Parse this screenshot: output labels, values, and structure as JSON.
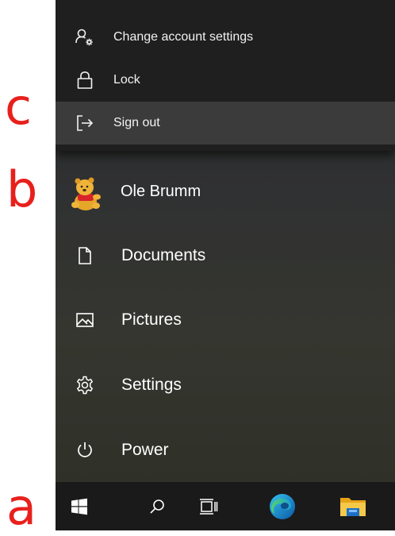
{
  "annotations": {
    "c": "c",
    "b": "b",
    "a": "a",
    "color": "#e8201c"
  },
  "flyout": {
    "items": [
      {
        "label": "Change account settings",
        "icon": "account-settings-icon"
      },
      {
        "label": "Lock",
        "icon": "lock-icon"
      },
      {
        "label": "Sign out",
        "icon": "sign-out-icon",
        "highlighted": true
      }
    ]
  },
  "user": {
    "name": "Ole Brumm",
    "avatar": "winnie-the-pooh-avatar"
  },
  "menu": {
    "items": [
      {
        "label": "Documents",
        "icon": "document-icon"
      },
      {
        "label": "Pictures",
        "icon": "pictures-icon"
      },
      {
        "label": "Settings",
        "icon": "gear-icon"
      },
      {
        "label": "Power",
        "icon": "power-icon"
      }
    ]
  },
  "taskbar": {
    "items": [
      "start-icon",
      "search-icon",
      "task-view-icon",
      "edge-icon",
      "file-explorer-icon"
    ]
  }
}
